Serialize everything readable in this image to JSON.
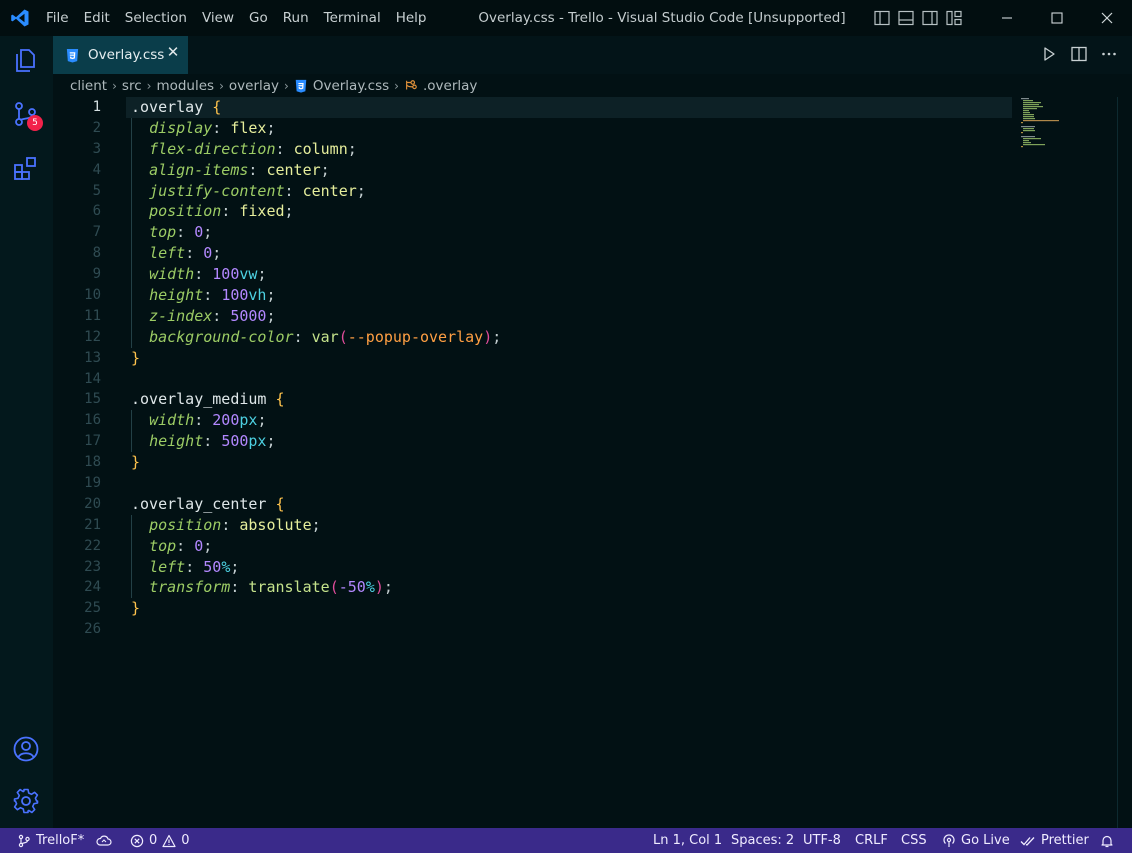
{
  "window": {
    "title": "Overlay.css - Trello - Visual Studio Code [Unsupported]",
    "menu": [
      "File",
      "Edit",
      "Selection",
      "View",
      "Go",
      "Run",
      "Terminal",
      "Help"
    ]
  },
  "activity_bar": {
    "source_control_badge": "5"
  },
  "tab": {
    "label": "Overlay.css",
    "close": "✕"
  },
  "breadcrumb": {
    "items": [
      "client",
      "src",
      "modules",
      "overlay",
      "Overlay.css",
      ".overlay"
    ],
    "separator": "›"
  },
  "editor": {
    "active_line": 1,
    "line_numbers": [
      "1",
      "2",
      "3",
      "4",
      "5",
      "6",
      "7",
      "8",
      "9",
      "10",
      "11",
      "12",
      "13",
      "14",
      "15",
      "16",
      "17",
      "18",
      "19",
      "20",
      "21",
      "22",
      "23",
      "24",
      "25",
      "26"
    ],
    "tokens": {
      "sel_overlay": ".overlay",
      "sel_medium": ".overlay_medium",
      "sel_center": ".overlay_center",
      "open": "{",
      "close": "}",
      "colon": ": ",
      "semi": ";",
      "display": "display",
      "flex": "flex",
      "flex_direction": "flex-direction",
      "column": "column",
      "align_items": "align-items",
      "center": "center",
      "justify_content": "justify-content",
      "position": "position",
      "fixed": "fixed",
      "top": "top",
      "zero": "0",
      "left": "left",
      "width": "width",
      "height": "height",
      "n100": "100",
      "vw": "vw",
      "vh": "vh",
      "z_index": "z-index",
      "n5000": "5000",
      "background_color": "background-color",
      "var": "var",
      "lparen": "(",
      "rparen": ")",
      "popup_overlay": "--popup-overlay",
      "n200": "200",
      "n500": "500",
      "px": "px",
      "absolute": "absolute",
      "n50": "50",
      "pct": "%",
      "transform": "transform",
      "translate": "translate",
      "neg50": "-50"
    }
  },
  "status_bar": {
    "branch": "TrelloF*",
    "errors": "0",
    "warnings": "0",
    "position": "Ln 1, Col 1",
    "spaces": "Spaces: 2",
    "encoding": "UTF-8",
    "eol": "CRLF",
    "language": "CSS",
    "go_live": "Go Live",
    "prettier": "Prettier"
  },
  "colors": {
    "background": "#021114",
    "status_bar": "#3a2a8a",
    "active_tab": "#0a3d4a",
    "accent_blue": "#2a8cff",
    "badge": "#f2224a",
    "activity_icons": "#4a72ff"
  },
  "icons": {
    "title": "vscode-logo-icon",
    "activity": [
      "explorer-icon",
      "source-control-icon",
      "extensions-icon",
      "accounts-icon",
      "settings-gear-icon"
    ],
    "layout": [
      "toggle-primary-sidebar-icon",
      "toggle-panel-icon",
      "toggle-secondary-sidebar-icon",
      "customize-layout-icon"
    ],
    "window": [
      "minimize-icon",
      "maximize-icon",
      "close-icon"
    ],
    "editor_actions": [
      "run-icon",
      "split-editor-icon",
      "more-actions-icon"
    ],
    "status": [
      "source-branch-icon",
      "sync-icon",
      "error-icon",
      "warning-icon",
      "broadcast-icon",
      "double-check-icon",
      "bell-icon"
    ]
  }
}
